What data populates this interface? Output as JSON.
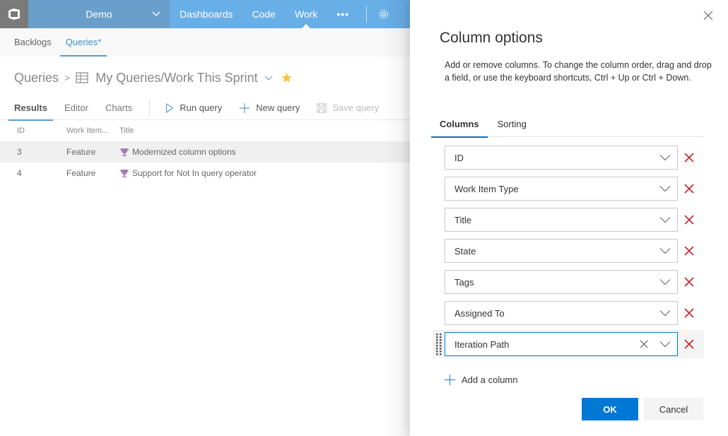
{
  "topbar": {
    "project": "Demo",
    "nav": [
      "Dashboards",
      "Code",
      "Work"
    ],
    "active_nav": "Work",
    "more_label": "•••"
  },
  "subnav": {
    "tabs": [
      "Backlogs",
      "Queries*"
    ],
    "active": "Queries*"
  },
  "breadcrumb": {
    "root": "Queries",
    "separator": ">",
    "query_title": "My Queries/Work This Sprint",
    "favorite": "★"
  },
  "toolbar": {
    "tabs": [
      "Results",
      "Editor",
      "Charts"
    ],
    "active_tab": "Results",
    "run_query": "Run query",
    "new_query": "New query",
    "save_query": "Save query"
  },
  "grid": {
    "columns": [
      "ID",
      "Work Item...",
      "Title"
    ],
    "rows": [
      {
        "id": "3",
        "type": "Feature",
        "title": "Modernized column options",
        "selected": true
      },
      {
        "id": "4",
        "type": "Feature",
        "title": "Support for Not In query operator",
        "selected": false
      }
    ]
  },
  "panel": {
    "title": "Column options",
    "description": "Add or remove columns. To change the column order, drag and drop a field, or use the keyboard shortcuts, Ctrl + Up or Ctrl + Down.",
    "tabs": [
      "Columns",
      "Sorting"
    ],
    "active_tab": "Columns",
    "columns": [
      {
        "value": "ID"
      },
      {
        "value": "Work Item Type"
      },
      {
        "value": "Title"
      },
      {
        "value": "State"
      },
      {
        "value": "Tags"
      },
      {
        "value": "Assigned To"
      },
      {
        "value": "Iteration Path",
        "focused": true
      }
    ],
    "add_column": "Add a column",
    "ok": "OK",
    "cancel": "Cancel"
  },
  "colors": {
    "topbar": "#68aee7",
    "project": "#6a9fcb",
    "primary": "#0078d4",
    "remove": "#c4262e",
    "favorite": "#f5c342",
    "trophy": "#a77bb5"
  }
}
